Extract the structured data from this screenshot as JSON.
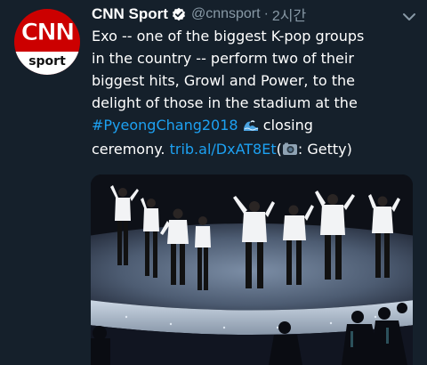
{
  "tweet": {
    "author": {
      "display_name": "CNN Sport",
      "handle": "@cnnsport",
      "avatar_logo_text": "CNN",
      "avatar_sub_text": "sport"
    },
    "separator": "·",
    "timestamp": "2시간",
    "text": {
      "line1": "Exo -- one of the biggest K-pop groups",
      "line2": "in the country -- perform two of their",
      "line3": "biggest hits, Growl and Power, to the",
      "line4": "delight of those in the stadium at the",
      "hashtag": "#PyeongChang2018",
      "line5_end": "closing",
      "line6_start": "ceremony.",
      "link": "trib.al/DxAT8Et",
      "credit_open": "(",
      "credit_text": ": Getty)"
    },
    "icons": {
      "verified": "verified-badge-icon",
      "menu": "chevron-down-icon",
      "emoji_1": "water-wave-emoji",
      "emoji_2": "camera-emoji"
    },
    "colors": {
      "background": "#15202b",
      "link": "#1da1f2",
      "secondary_text": "#8899a6",
      "brand_red": "#cc0000"
    },
    "media": {
      "type": "photo",
      "subject": "stadium-performance"
    }
  }
}
